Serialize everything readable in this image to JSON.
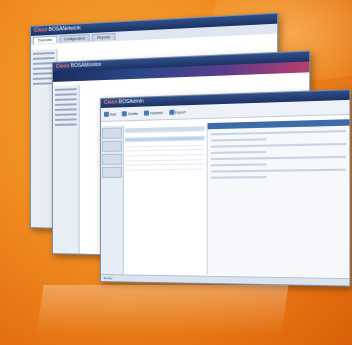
{
  "back_window": {
    "brand": "Cisco",
    "title": "BOSANetwork",
    "tabs": [
      "Overview",
      "Configuration",
      "Reports"
    ]
  },
  "middle_window": {
    "brand": "Cisco",
    "title": "BOSAMonitor"
  },
  "front_window": {
    "brand": "Cisco",
    "title": "BOSAdmin",
    "toolbar": [
      "Add",
      "Delete",
      "Refresh",
      "Export"
    ],
    "status": "Ready"
  },
  "colors": {
    "background": "#ef8a1f",
    "titlebar": "#1c3263",
    "accent": "#3d6aa8"
  }
}
